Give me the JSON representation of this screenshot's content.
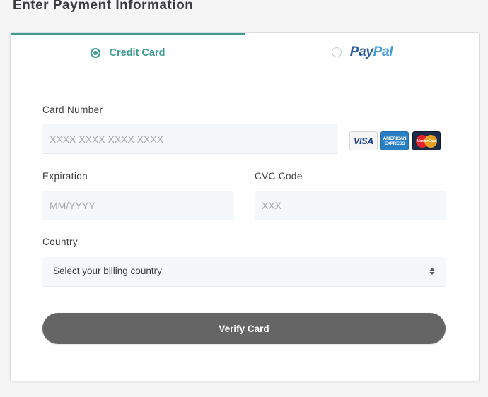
{
  "page": {
    "title": "Enter Payment Information"
  },
  "tabs": {
    "credit_card": {
      "label": "Credit Card",
      "selected": true
    },
    "paypal": {
      "label_part1": "Pay",
      "label_part2": "Pal",
      "selected": false
    }
  },
  "form": {
    "card_number": {
      "label": "Card Number",
      "placeholder": "XXXX XXXX XXXX XXXX",
      "value": ""
    },
    "expiration": {
      "label": "Expiration",
      "placeholder": "MM/YYYY",
      "value": ""
    },
    "cvc": {
      "label": "CVC Code",
      "placeholder": "XXX",
      "value": ""
    },
    "country": {
      "label": "Country",
      "selected_value": "Select your billing country"
    },
    "submit_label": "Verify Card"
  },
  "card_logos": {
    "visa": "VISA",
    "amex_line1": "AMERICAN",
    "amex_line2": "EXPRESS",
    "mastercard": "MasterCard"
  },
  "icons": {
    "credit_radio": "radio-selected-icon",
    "paypal_radio": "radio-unselected-icon",
    "select_arrows": "sort-arrows-icon"
  },
  "colors": {
    "accent": "#3c9b92",
    "button": "#656565",
    "input_bg": "#f4f8fa",
    "text": "#3b3b3f",
    "paypal_dark": "#2b5d97",
    "paypal_light": "#3f9fd8"
  }
}
